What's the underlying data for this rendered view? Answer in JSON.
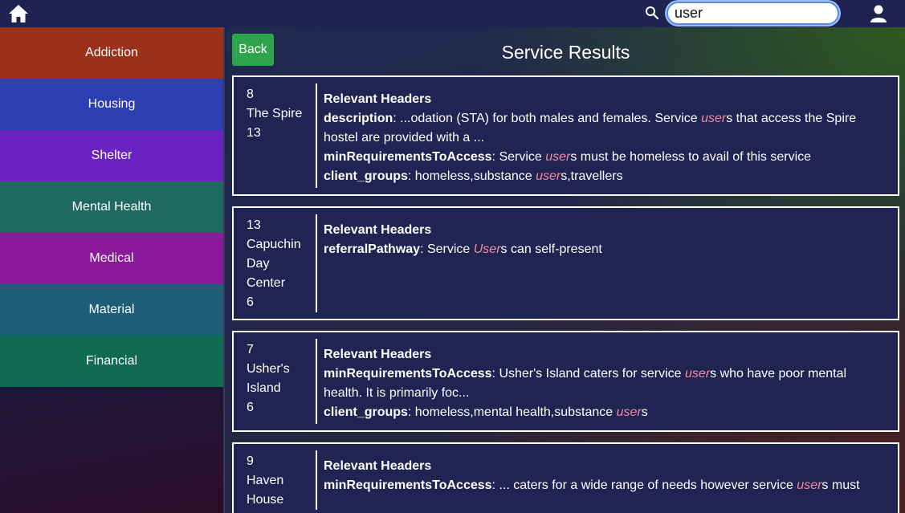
{
  "search": {
    "value": "user"
  },
  "sidebar": {
    "items": [
      {
        "label": "Addiction",
        "color": "#9b3119"
      },
      {
        "label": "Housing",
        "color": "#2d3fb0"
      },
      {
        "label": "Shelter",
        "color": "#6a22c0"
      },
      {
        "label": "Mental Health",
        "color": "#1e6a62"
      },
      {
        "label": "Medical",
        "color": "#8a1a9a"
      },
      {
        "label": "Material",
        "color": "#1e5f78"
      },
      {
        "label": "Financial",
        "color": "#0f6a50"
      }
    ]
  },
  "main": {
    "back_label": "Back",
    "title": "Service Results",
    "relevant_label": "Relevant Headers"
  },
  "results": [
    {
      "id": "8",
      "name_lines": [
        "The Spire"
      ],
      "count": "13",
      "fields": [
        {
          "key": "description",
          "parts": [
            ": ...odation (STA) for both males and females. Service ",
            "user",
            "s that access the Spire hostel are provided with a ..."
          ]
        },
        {
          "key": "minRequirementsToAccess",
          "parts": [
            ": Service ",
            "user",
            "s must be homeless to avail of this service"
          ]
        },
        {
          "key": "client_groups",
          "parts": [
            ": homeless,substance ",
            "user",
            "s,travellers"
          ]
        }
      ]
    },
    {
      "id": "13",
      "name_lines": [
        "Capuchin",
        "Day",
        "Center"
      ],
      "count": "6",
      "fields": [
        {
          "key": "referralPathway",
          "parts": [
            ": Service ",
            "User",
            "s can self-present"
          ]
        }
      ]
    },
    {
      "id": "7",
      "name_lines": [
        "Usher's",
        "Island"
      ],
      "count": "6",
      "fields": [
        {
          "key": "minRequirementsToAccess",
          "parts": [
            ": Usher's Island caters for service ",
            "user",
            "s who have poor mental health. It is primarily foc..."
          ]
        },
        {
          "key": "client_groups",
          "parts": [
            ": homeless,mental health,substance ",
            "user",
            "s"
          ]
        }
      ]
    },
    {
      "id": "9",
      "name_lines": [
        "Haven",
        "House"
      ],
      "count": "",
      "fields": [
        {
          "key": "minRequirementsToAccess",
          "parts": [
            ": ... caters for a wide range of needs however service ",
            "user",
            "s must"
          ]
        }
      ]
    }
  ]
}
